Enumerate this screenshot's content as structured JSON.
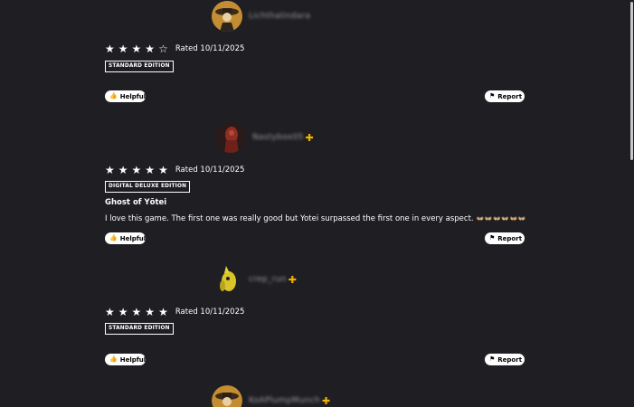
{
  "reviews": [
    {
      "username": "Lichthalindara",
      "plus": false,
      "avatar": "samurai-avatar-icon",
      "stars": 4,
      "rated": "Rated 10/11/2025",
      "edition": "STANDARD EDITION",
      "title": "",
      "body": "",
      "helpful_label": "Helpful",
      "report_label": "Report"
    },
    {
      "username": "Nastybox05",
      "plus": true,
      "avatar": "red-warrior-avatar-icon",
      "stars": 5,
      "rated": "Rated 10/11/2025",
      "edition": "DIGITAL DELUXE EDITION",
      "title": "Ghost of Yōtei",
      "body": "I love this game. The first one was really good but Yotei surpassed the first one in every aspect.",
      "emoji": "👐🏼👐🏼👐🏼👐🏼👐🏼👐🏼",
      "helpful_label": "Helpful",
      "report_label": "Report"
    },
    {
      "username": "crep_run",
      "plus": true,
      "avatar": "yellow-creature-avatar-icon",
      "stars": 5,
      "rated": "Rated 10/11/2025",
      "edition": "STANDARD EDITION",
      "title": "",
      "body": "",
      "helpful_label": "Helpful",
      "report_label": "Report"
    },
    {
      "username": "KoAPlumpMunch",
      "plus": true,
      "avatar": "samurai-avatar-icon",
      "stars": null,
      "rated": "",
      "edition": "",
      "title": "",
      "body": ""
    }
  ],
  "plus_symbol": "✚",
  "colors": {
    "background": "#1f1f23",
    "plus": "#f0b100",
    "text": "#ffffff"
  }
}
